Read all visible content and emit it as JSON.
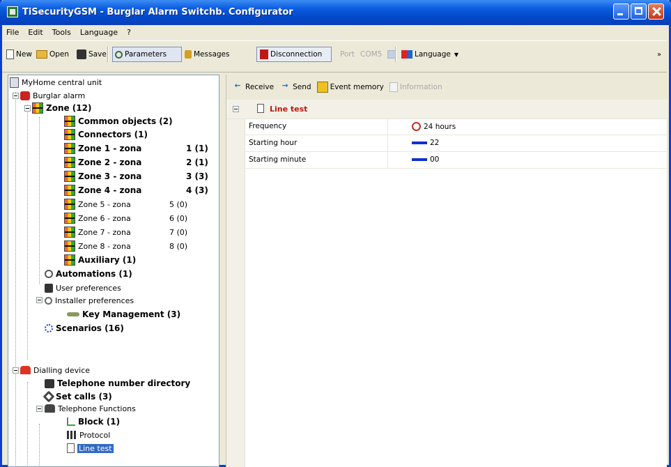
{
  "window": {
    "title": "TiSecurityGSM - Burglar Alarm Switchb. Configurator"
  },
  "menu": [
    "File",
    "Edit",
    "Tools",
    "Language",
    "?"
  ],
  "toolbar": {
    "new": "New",
    "open": "Open",
    "save": "Save",
    "parameters": "Parameters",
    "messages": "Messages",
    "disconnection": "Disconnection",
    "port_label": "Port",
    "port_value": "COM5",
    "language": "Language",
    "overflow": "»"
  },
  "tree": {
    "root": "MyHome central unit",
    "burglar_alarm": "Burglar alarm",
    "zone": "Zone (12)",
    "common_objects": "Common objects (2)",
    "connectors": "Connectors (1)",
    "zones": [
      {
        "name": "Zone 1 - zona",
        "count": "1 (1)"
      },
      {
        "name": "Zone 2 - zona",
        "count": "2 (1)"
      },
      {
        "name": "Zone 3 - zona",
        "count": "3 (3)"
      },
      {
        "name": "Zone 4 - zona",
        "count": "4 (3)"
      },
      {
        "name": "Zone 5 - zona",
        "count": "5 (0)"
      },
      {
        "name": "Zone 6 - zona",
        "count": "6 (0)"
      },
      {
        "name": "Zone 7 - zona",
        "count": "7 (0)"
      },
      {
        "name": "Zone 8 - zona",
        "count": "8 (0)"
      }
    ],
    "auxiliary": "Auxiliary (1)",
    "automations": "Automations (1)",
    "user_preferences": "User preferences",
    "installer_preferences": "Installer preferences",
    "key_management": "Key Management (3)",
    "scenarios": "Scenarios (16)",
    "dialling_device": "Dialling device",
    "telephone_directory": "Telephone number directory",
    "set_calls": "Set calls (3)",
    "telephone_functions": "Telephone Functions",
    "block": "Block (1)",
    "protocol": "Protocol",
    "line_test": "Line test"
  },
  "panel": {
    "receive": "Receive",
    "send": "Send",
    "event_memory": "Event memory",
    "information": "Information",
    "section": "Line test",
    "rows": [
      {
        "key": "Frequency",
        "value": "24 hours"
      },
      {
        "key": "Starting hour",
        "value": "22"
      },
      {
        "key": "Starting minute",
        "value": "00"
      }
    ]
  }
}
